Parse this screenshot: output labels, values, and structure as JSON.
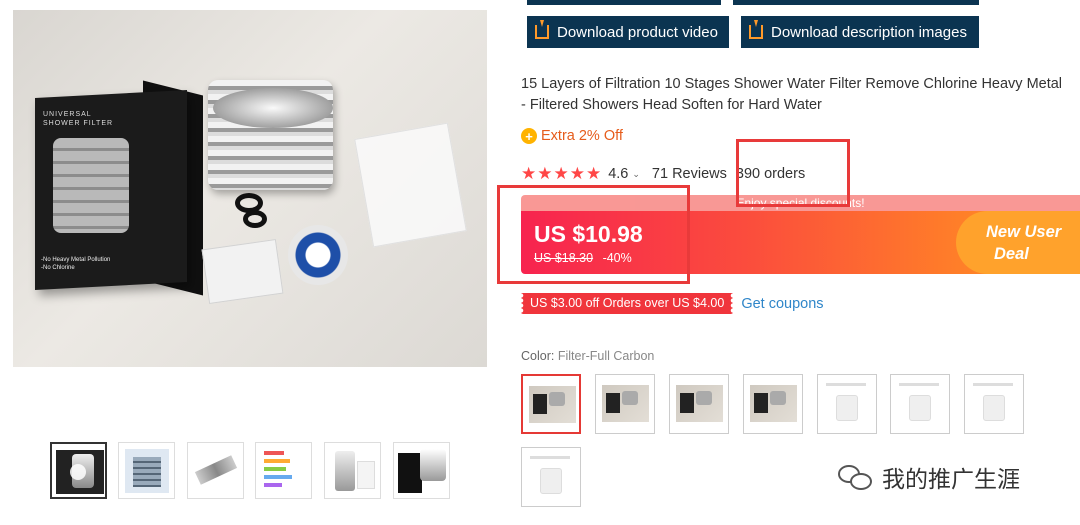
{
  "actions": {
    "download_video": "Download product video",
    "download_images": "Download description images"
  },
  "product": {
    "title_line1": "15 Layers of Filtration 10 Stages Shower Water Filter Remove Chlorine Heavy Metal",
    "title_line2": "- Filtered Showers Head Soften for Hard Water",
    "extra_off": "Extra 2% Off",
    "stars": "★★★★★",
    "rating": "4.6",
    "reviews": "71 Reviews",
    "orders": "390 orders"
  },
  "price": {
    "promo_strip": "Enjoy special discounts!",
    "current": "US $10.98",
    "original": "US $18.30",
    "discount": "-40%",
    "deal_line1": "New User",
    "deal_line2": "Deal"
  },
  "coupon": {
    "text": "US $3.00 off Orders over US $4.00",
    "link": "Get coupons"
  },
  "variants": {
    "label": "Color:",
    "selected_value": "Filter-Full Carbon"
  },
  "gallery": {
    "box_brand_line1": "UNIVERSAL",
    "box_brand_line2": "SHOWER FILTER",
    "box_bottom_line1": "-No Heavy Metal Pollution",
    "box_bottom_line2": "-No Chlorine"
  },
  "watermark": {
    "text": "我的推广生涯"
  },
  "colors": {
    "download_bg": "#0b3451",
    "price_red": "#f7234f",
    "accent_orange": "#ff9a23",
    "link_blue": "#2f86c9",
    "annotation_red": "#e83a3a"
  }
}
